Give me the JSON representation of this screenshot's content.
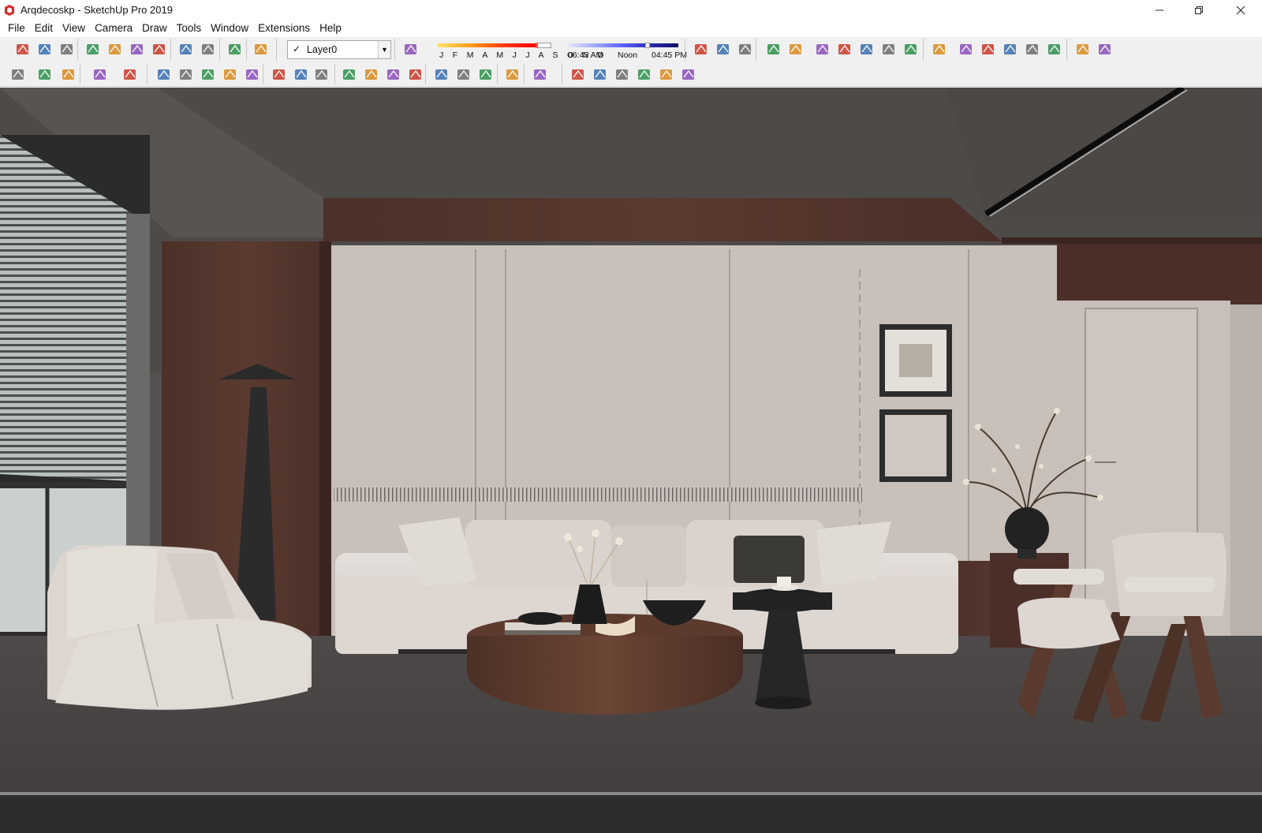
{
  "app": {
    "title": "Arqdecoskp - SketchUp Pro 2019",
    "brand_color": "#d52b2b"
  },
  "window_controls": {
    "minimize_icon": "minimize-icon",
    "maximize_icon": "restore-icon",
    "close_icon": "close-icon"
  },
  "menu": [
    "File",
    "Edit",
    "View",
    "Camera",
    "Draw",
    "Tools",
    "Window",
    "Extensions",
    "Help"
  ],
  "layers": {
    "current": "Layer0",
    "checked": true
  },
  "shadows": {
    "months": "J F M A M J J A S O N D",
    "time_start": "06:43 AM",
    "time_mid": "Noon",
    "time_end": "04:45 PM"
  },
  "toolbar_row1": [
    "new-model-icon",
    "open-icon",
    "save-icon",
    "cut-icon",
    "copy-icon",
    "paste-icon",
    "erase-icon",
    "undo-icon",
    "redo-icon",
    "print-icon",
    "model-info-icon",
    "eraser-icon",
    "styles-icon",
    "xray-icon",
    "back-edges-icon",
    "wireframe-icon",
    "hidden-line-icon",
    "shaded-icon",
    "textured-icon",
    "monochrome-icon",
    "iso-view-icon",
    "top-view-icon",
    "front-view-icon",
    "right-view-icon",
    "back-view-icon",
    "left-view-icon",
    "select-icon",
    "make-component-icon",
    "paint-bucket-icon",
    "eraser-icon-2"
  ],
  "toolbar_row2": [
    "select-icon",
    "eraser-icon",
    "line-icon",
    "arc-icon",
    "rectangle-icon",
    "push-pull-icon",
    "follow-me-icon",
    "move-icon",
    "rotate-icon",
    "scale-icon",
    "tape-measure-icon",
    "text-icon",
    "paint-icon",
    "orbit-icon",
    "pan-icon",
    "zoom-icon",
    "zoom-extents-icon",
    "warehouse-icon",
    "extension-warehouse-icon",
    "layout-icon",
    "ruby-icon",
    "account-icon",
    "iso-house-icon",
    "section-icon",
    "home-icon",
    "house-box-icon",
    "house-outline-icon",
    "roof-icon"
  ]
}
